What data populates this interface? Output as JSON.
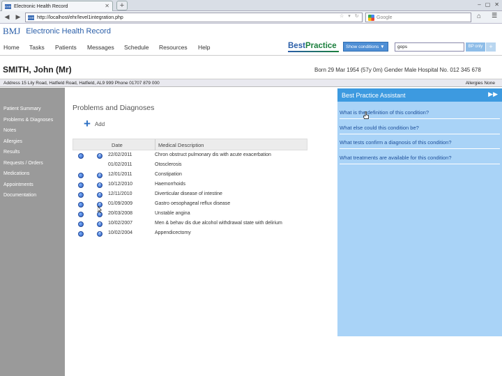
{
  "browser": {
    "tab_title": "Electronic Health Record",
    "url": "http://localhost/ehr/level1integration.php",
    "search_placeholder": "Google",
    "fav_text": "EHR"
  },
  "app": {
    "logo": "BMJ",
    "title": "Electronic Health Record",
    "menu": [
      "Home",
      "Tasks",
      "Patients",
      "Messages",
      "Schedule",
      "Resources",
      "Help"
    ]
  },
  "bestpractice": {
    "logo_a": "Best",
    "logo_b": "Practice",
    "show_conditions": "Show conditions ▼",
    "search_value": "gops",
    "bp_only": "BP only",
    "plus": "+"
  },
  "patient": {
    "name": "SMITH, John (Mr)",
    "info": "Born 29 Mar 1954 (57y 0m) Gender Male Hospital No. 012 345 678",
    "address": "Address 15 Lily Road, Hatfield Road, Hatfield, AL9 999     Phone 01707 879 000",
    "allergies": "Allergies None"
  },
  "sidebar": {
    "items": [
      "Patient Summary",
      "Problems & Diagnoses",
      "Notes",
      "Allergies",
      "Results",
      "Requests / Orders",
      "Medications",
      "Appointments",
      "Documentation"
    ]
  },
  "content": {
    "title": "Problems and Diagnoses",
    "add_label": "Add",
    "columns": [
      "Date",
      "Medical Description"
    ],
    "rows": [
      {
        "date": "22/02/2011",
        "desc": "Chron obstruct pulmonary dis with acute exacerbation"
      },
      {
        "date": "01/02/2011",
        "desc": "Otosclerosis"
      },
      {
        "date": "12/01/2011",
        "desc": "Constipation"
      },
      {
        "date": "10/12/2010",
        "desc": "Haemorrhoids"
      },
      {
        "date": "12/11/2010",
        "desc": "Diverticular disease of intestine"
      },
      {
        "date": "01/09/2009",
        "desc": "Gastro oesophageal reflux disease"
      },
      {
        "date": "20/03/2008",
        "desc": "Unstable angina"
      },
      {
        "date": "10/02/2007",
        "desc": "Men & behav dis due alcohol withdrawal state with delirium"
      },
      {
        "date": "10/02/2004",
        "desc": "Appendicectomy"
      }
    ]
  },
  "assistant": {
    "title": "Best Practice Assistant",
    "toggle": "▶▶",
    "links": [
      "What is the definition of this condition?",
      "What else could this condition be?",
      "What tests confirm a diagnosis of this condition?",
      "What treatments are available for this condition?"
    ]
  }
}
